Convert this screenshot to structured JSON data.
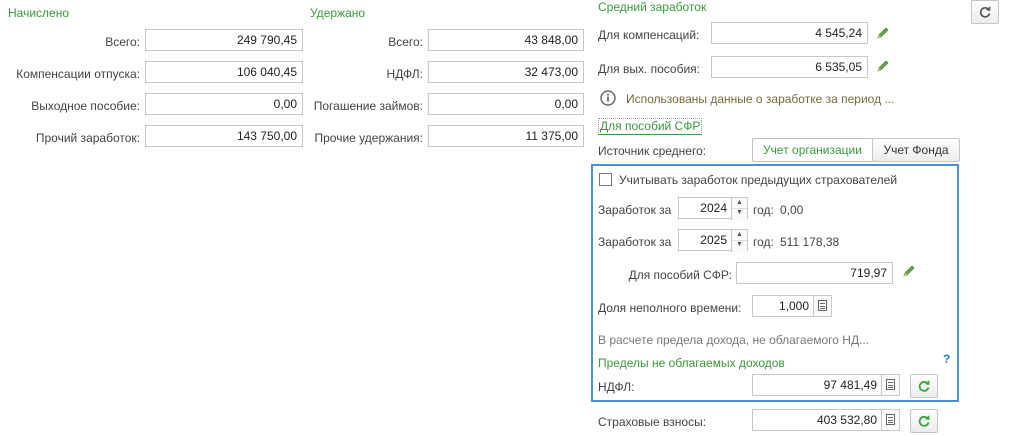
{
  "accrued": {
    "header": "Начислено",
    "rows": [
      {
        "label": "Всего:",
        "value": "249 790,45"
      },
      {
        "label": "Компенсации отпуска:",
        "value": "106 040,45"
      },
      {
        "label": "Выходное пособие:",
        "value": "0,00"
      },
      {
        "label": "Прочий заработок:",
        "value": "143 750,00"
      }
    ]
  },
  "withheld": {
    "header": "Удержано",
    "rows": [
      {
        "label": "Всего:",
        "value": "43 848,00"
      },
      {
        "label": "НДФЛ:",
        "value": "32 473,00"
      },
      {
        "label": "Погашение займов:",
        "value": "0,00"
      },
      {
        "label": "Прочие удержания:",
        "value": "11 375,00"
      }
    ]
  },
  "average": {
    "header": "Средний заработок",
    "compensation_label": "Для компенсаций:",
    "compensation_value": "4 545,24",
    "severance_label": "Для вых. пособия:",
    "severance_value": "6 535,05",
    "info_text": "Использованы данные о заработке за период ...",
    "sfr_link": "Для пособий СФР",
    "source_label": "Источник среднего:",
    "source_options": [
      "Учет организации",
      "Учет Фонда"
    ],
    "source_selected": "Учет организации"
  },
  "sfr_panel": {
    "prev_insurers_label": "Учитывать заработок предыдущих страхователей",
    "earnings_label": "Заработок за",
    "year_suffix": "год:",
    "years": [
      {
        "year": "2024",
        "amount": "0,00"
      },
      {
        "year": "2025",
        "amount": "511 178,38"
      }
    ],
    "sfr_benefit_label": "Для пособий СФР:",
    "sfr_benefit_value": "719,97",
    "part_time_label": "Доля неполного времени:",
    "part_time_value": "1,000",
    "limit_note": "В расчете предела дохода, не облагаемого НД...",
    "limits_header": "Пределы не облагаемых доходов",
    "help_mark": "?",
    "ndfl_label": "НДФЛ:",
    "ndfl_value": "97 481,49"
  },
  "insurance": {
    "label": "Страховые взносы:",
    "value": "403 532,80"
  },
  "colors": {
    "header_green": "#3a9a3a",
    "panel_border": "#4a90d9",
    "refresh_green": "#3aa63a",
    "pencil_green": "#6aa84f"
  }
}
